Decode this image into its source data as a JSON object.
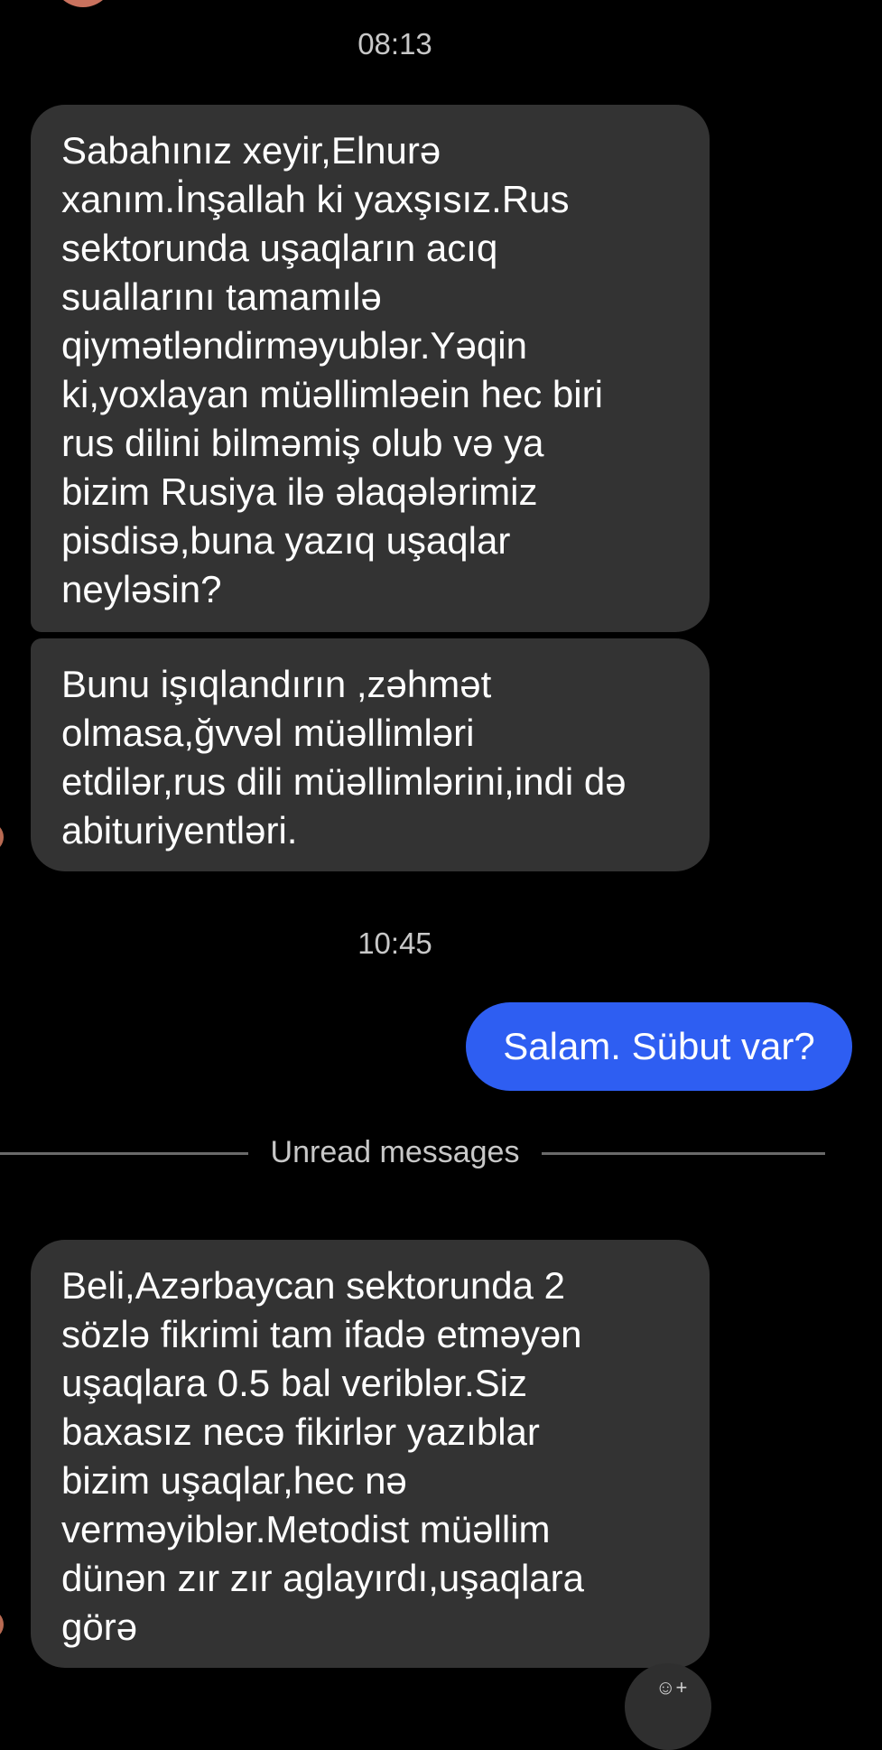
{
  "timestamps": [
    "08:13",
    "10:45"
  ],
  "messages": {
    "incoming_1": "Sabahınız xeyir,Elnurə\nxanım.İnşallah ki yaxşısız.Rus\nsektorunda uşaqların acıq\nsuallarını tamamılə\nqiymətləndirməyublər.Yəqin\nki,yoxlayan müəllimləein hec biri\nrus dilini bilməmiş olub və ya\nbizim Rusiya ilə əlaqələrimiz\npisdisə,buna yazıq uşaqlar\nneyləsin?",
    "incoming_2": "Bunu işıqlandırın ,zəhmət\nolmasa,ğvvəl müəllimləri\netdilər,rus dili müəllimlərini,indi də\nabituriyentləri.",
    "outgoing_1": "Salam. Sübut var?",
    "incoming_3": "Beli,Azərbaycan sektorunda 2\nsözlə fikrimi tam ifadə etməyən\nuşaqlara 0.5 bal veriblər.Siz\nbaxasız necə fikirlər yazıblar\nbizim uşaqlar,hec nə\nverməyiblər.Metodist müəllim\ndünən zır zır aglayırdı,uşaqlara\ngörə"
  },
  "divider": {
    "label": "Unread messages"
  },
  "colors": {
    "background": "#000000",
    "incoming_bubble": "#333333",
    "outgoing_bubble": "#2e5ef2",
    "timestamp_text": "#c8c8c8"
  },
  "icons": {
    "fab": "emoji-add-icon"
  }
}
